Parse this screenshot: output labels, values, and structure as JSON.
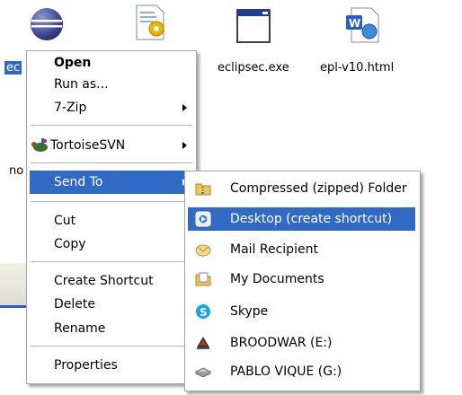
{
  "desktop": {
    "icons": [
      {
        "label": "ec",
        "icon": "eclipse-icon"
      },
      {
        "label": "",
        "icon": "settings-file-icon"
      },
      {
        "label": "eclipsec.exe",
        "icon": "window-app-icon"
      },
      {
        "label": "epl-v10.html",
        "icon": "word-document-icon"
      },
      {
        "label": "no",
        "icon": "unknown-file-icon"
      }
    ]
  },
  "context_menu": {
    "items": [
      {
        "label": "Open"
      },
      {
        "label": "Run as..."
      },
      {
        "label": "7-Zip"
      },
      {
        "label": "TortoiseSVN"
      },
      {
        "label": "Send To"
      },
      {
        "label": "Cut"
      },
      {
        "label": "Copy"
      },
      {
        "label": "Create Shortcut"
      },
      {
        "label": "Delete"
      },
      {
        "label": "Rename"
      },
      {
        "label": "Properties"
      }
    ]
  },
  "send_to_menu": {
    "items": [
      {
        "label": "Compressed (zipped) Folder",
        "icon": "zip-folder-icon"
      },
      {
        "label": "Desktop (create shortcut)",
        "icon": "desktop-icon"
      },
      {
        "label": "Mail Recipient",
        "icon": "mail-icon"
      },
      {
        "label": "My Documents",
        "icon": "documents-folder-icon"
      },
      {
        "label": "Skype",
        "icon": "skype-icon"
      },
      {
        "label": "BROODWAR (E:)",
        "icon": "cd-drive-icon"
      },
      {
        "label": "PABLO VIQUE (G:)",
        "icon": "removable-drive-icon"
      }
    ]
  },
  "colors": {
    "highlight": "#316ac5",
    "menu_border": "#a5a5a5"
  }
}
